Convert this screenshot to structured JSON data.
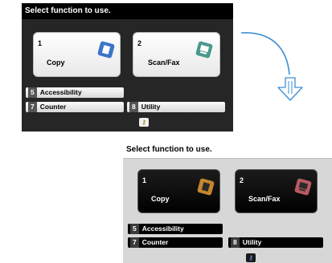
{
  "top_screen": {
    "title": "Select function to use.",
    "tiles": [
      {
        "number": "1",
        "label": "Copy",
        "icon": "copy-icon",
        "icon_color": "#3a73c9"
      },
      {
        "number": "2",
        "label": "Scan/Fax",
        "icon": "scan-fax-icon",
        "icon_color": "#4a9a8c"
      }
    ],
    "buttons": {
      "accessibility": {
        "number": "5",
        "label": "Accessibility"
      },
      "counter": {
        "number": "7",
        "label": "Counter"
      },
      "utility": {
        "number": "8",
        "label": "Utility"
      }
    },
    "key_icon": "key-icon",
    "key_glyph": "⚷"
  },
  "bottom_screen": {
    "title": "Select function to use.",
    "tiles": [
      {
        "number": "1",
        "label": "Copy",
        "icon": "copy-icon",
        "icon_color": "#c5862f"
      },
      {
        "number": "2",
        "label": "Scan/Fax",
        "icon": "scan-fax-icon",
        "icon_color": "#b75a63"
      }
    ],
    "buttons": {
      "accessibility": {
        "number": "5",
        "label": "Accessibility"
      },
      "counter": {
        "number": "7",
        "label": "Counter"
      },
      "utility": {
        "number": "8",
        "label": "Utility"
      }
    },
    "key_icon": "key-icon",
    "key_glyph": "⚷"
  },
  "arrow": {
    "icon": "curved-arrow-down-icon",
    "color": "#3a8fd6"
  }
}
